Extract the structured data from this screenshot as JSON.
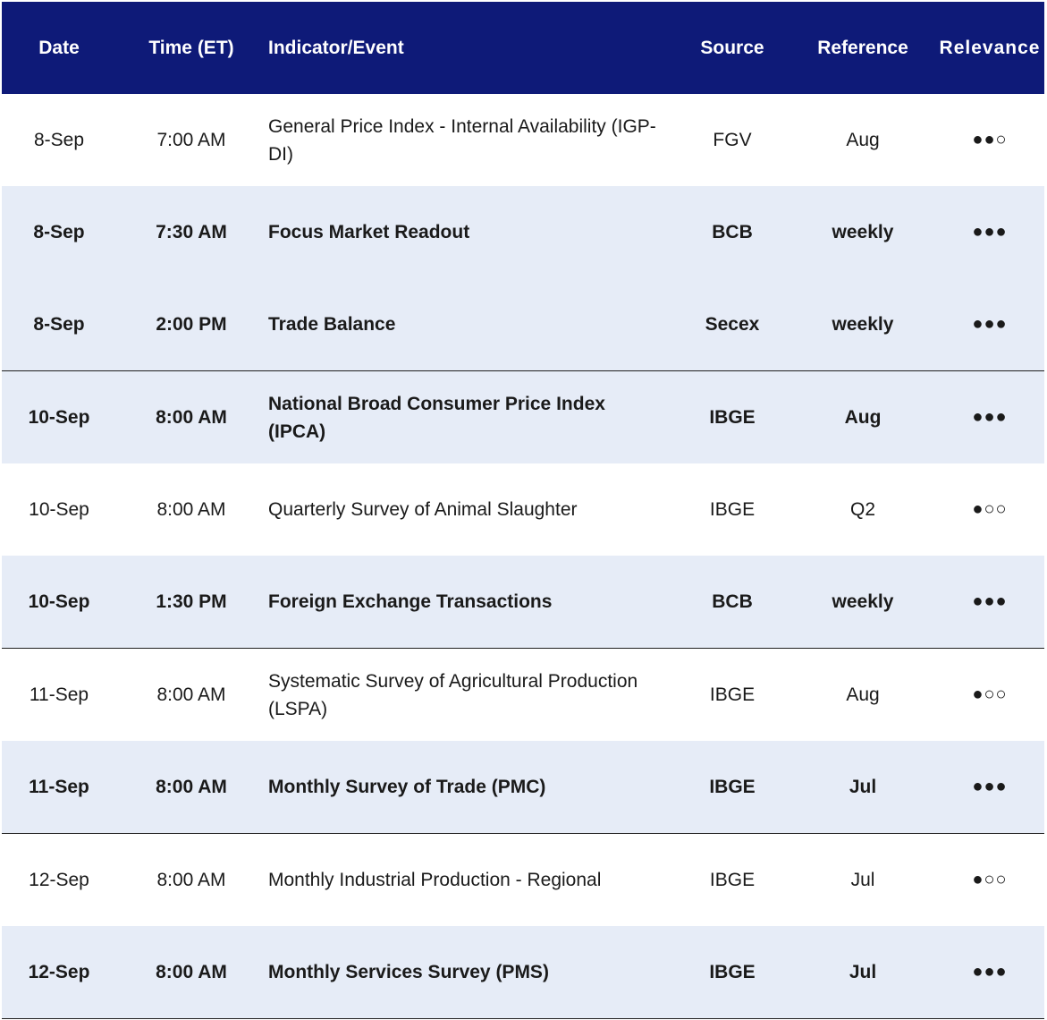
{
  "columns": [
    "Date",
    "Time (ET)",
    "Indicator/Event",
    "Source",
    "Reference",
    "Relevance"
  ],
  "rows": [
    {
      "date": "8-Sep",
      "time": "7:00 AM",
      "event": "General Price Index - Internal Availability (IGP-DI)",
      "source": "FGV",
      "reference": "Aug",
      "relevance": "●●○",
      "bold": false,
      "shade": false,
      "sep": false
    },
    {
      "date": "8-Sep",
      "time": "7:30 AM",
      "event": "Focus Market Readout",
      "source": "BCB",
      "reference": "weekly",
      "relevance": "●●●",
      "bold": true,
      "shade": true,
      "sep": false
    },
    {
      "date": "8-Sep",
      "time": "2:00 PM",
      "event": "Trade Balance",
      "source": "Secex",
      "reference": "weekly",
      "relevance": "●●●",
      "bold": true,
      "shade": true,
      "sep": true
    },
    {
      "date": "10-Sep",
      "time": "8:00 AM",
      "event": "National Broad Consumer Price Index (IPCA)",
      "source": "IBGE",
      "reference": "Aug",
      "relevance": "●●●",
      "bold": true,
      "shade": true,
      "sep": false
    },
    {
      "date": "10-Sep",
      "time": "8:00 AM",
      "event": "Quarterly Survey of Animal Slaughter",
      "source": "IBGE",
      "reference": "Q2",
      "relevance": "●○○",
      "bold": false,
      "shade": false,
      "sep": false
    },
    {
      "date": "10-Sep",
      "time": "1:30 PM",
      "event": "Foreign Exchange Transactions",
      "source": "BCB",
      "reference": "weekly",
      "relevance": "●●●",
      "bold": true,
      "shade": true,
      "sep": true
    },
    {
      "date": "11-Sep",
      "time": "8:00 AM",
      "event": "Systematic Survey of Agricultural Production (LSPA)",
      "source": "IBGE",
      "reference": "Aug",
      "relevance": "●○○",
      "bold": false,
      "shade": false,
      "sep": false
    },
    {
      "date": "11-Sep",
      "time": "8:00 AM",
      "event": "Monthly Survey of Trade (PMC)",
      "source": "IBGE",
      "reference": "Jul",
      "relevance": "●●●",
      "bold": true,
      "shade": true,
      "sep": true
    },
    {
      "date": "12-Sep",
      "time": "8:00 AM",
      "event": "Monthly Industrial Production - Regional",
      "source": "IBGE",
      "reference": "Jul",
      "relevance": "●○○",
      "bold": false,
      "shade": false,
      "sep": false
    },
    {
      "date": "12-Sep",
      "time": "8:00 AM",
      "event": "Monthly Services Survey (PMS)",
      "source": "IBGE",
      "reference": "Jul",
      "relevance": "●●●",
      "bold": true,
      "shade": true,
      "sep": true
    }
  ],
  "colors": {
    "header_bg": "#0e1a78",
    "header_text": "#ffffff",
    "shade_bg": "#e6ecf7"
  }
}
